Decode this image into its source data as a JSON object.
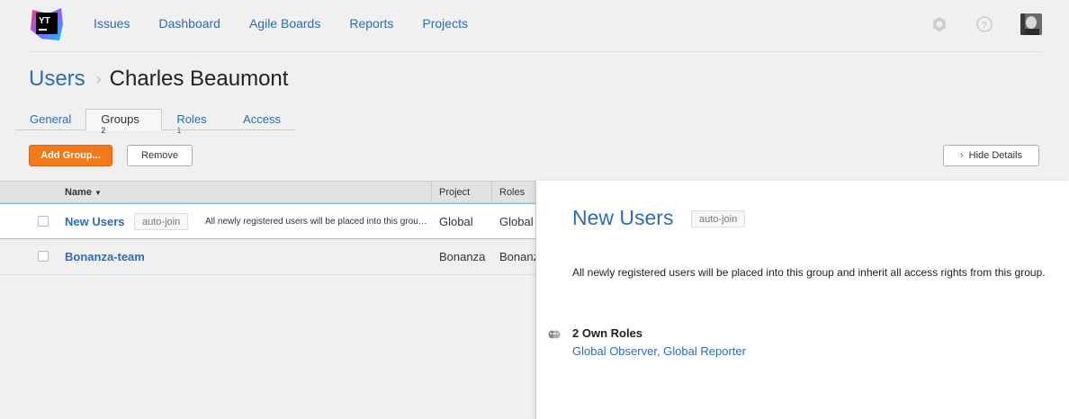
{
  "nav": {
    "items": [
      "Issues",
      "Dashboard",
      "Agile Boards",
      "Reports",
      "Projects"
    ],
    "icons": [
      "settings-icon",
      "help-icon",
      "avatar"
    ]
  },
  "breadcrumb": {
    "parent": "Users",
    "current": "Charles Beaumont"
  },
  "tabs": [
    {
      "label": "General",
      "count": ""
    },
    {
      "label": "Groups",
      "count": "2"
    },
    {
      "label": "Roles",
      "count": "1"
    },
    {
      "label": "Access",
      "count": ""
    }
  ],
  "toolbar": {
    "add_label": "Add Group...",
    "remove_label": "Remove",
    "hide_label": "Hide Details"
  },
  "grid": {
    "columns": {
      "name": "Name",
      "project": "Project",
      "roles": "Roles"
    },
    "rows": [
      {
        "name": "New Users",
        "tag": "auto-join",
        "description": "All newly registered users will be placed into this group and inherit all access rights from this group.",
        "project": "Global",
        "roles": "Global Observer, Global Reporter"
      },
      {
        "name": "Bonanza-team",
        "tag": "",
        "description": "",
        "project": "Bonanza",
        "roles": "Bonanza"
      }
    ]
  },
  "details": {
    "title": "New Users",
    "tag": "auto-join",
    "description": "All newly registered users will be placed into this group and inherit all access rights from this group.",
    "roles_heading": "2 Own Roles",
    "roles": [
      "Global Observer",
      "Global Reporter"
    ]
  },
  "colors": {
    "link": "#2e6db4",
    "primary": "#f27a1a",
    "selection": "#7ec3e6"
  }
}
